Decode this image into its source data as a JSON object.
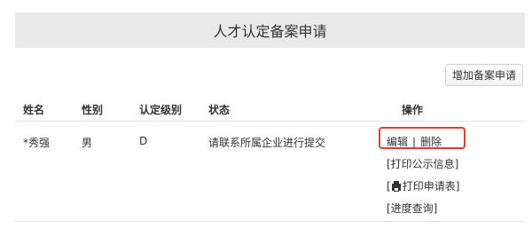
{
  "page": {
    "title": "人才认定备案申请",
    "add_button": "增加备案申请"
  },
  "table": {
    "headers": {
      "name": "姓名",
      "gender": "性别",
      "level": "认定级别",
      "status": "状态",
      "actions": "操作"
    },
    "rows": [
      {
        "name": "*秀强",
        "gender": "男",
        "level": "D",
        "status": "请联系所属企业进行提交",
        "actions": {
          "edit": "编辑",
          "separator": "|",
          "delete": "删除",
          "print_notice": "[打印公示信息]",
          "print_form_prefix": "[",
          "print_form_label": "打印申请表]",
          "progress": "[进度查询]"
        }
      }
    ]
  },
  "icons": {
    "print_form_icon": "printer-icon"
  },
  "colors": {
    "highlight_border": "#d94333"
  }
}
